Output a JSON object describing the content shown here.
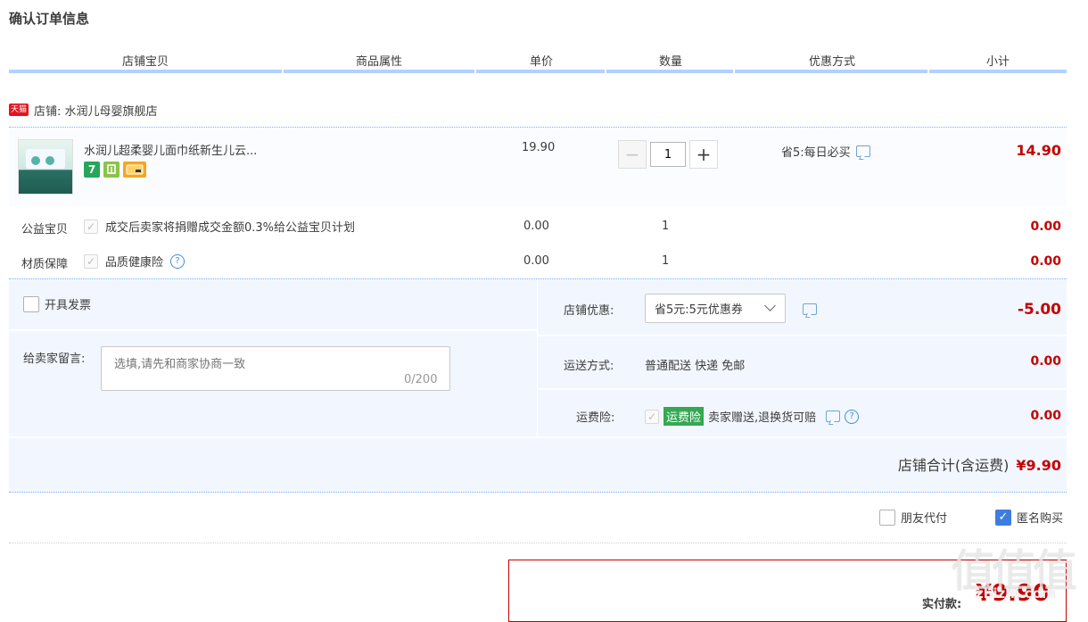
{
  "page_title": "确认订单信息",
  "columns": [
    "店铺宝贝",
    "商品属性",
    "单价",
    "数量",
    "优惠方式",
    "小计"
  ],
  "shop": {
    "badge": "天猫",
    "label": "店铺: 水润儿母婴旗舰店"
  },
  "item": {
    "name": "水润儿超柔婴儿面巾纸新生儿云...",
    "badges": [
      "7",
      "",
      ""
    ],
    "price": "19.90",
    "quantity": "1",
    "minus": "−",
    "plus": "+",
    "promo": "省5:每日必买",
    "subtotal": "14.90"
  },
  "services": [
    {
      "label": "公益宝贝",
      "text": "成交后卖家将捐赠成交金额0.3%给公益宝贝计划",
      "price": "0.00",
      "qty": "1",
      "subtotal": "0.00"
    },
    {
      "label": "材质保障",
      "text": "品质健康险",
      "price": "0.00",
      "qty": "1",
      "subtotal": "0.00"
    }
  ],
  "invoice": {
    "label": "开具发票"
  },
  "message": {
    "label": "给卖家留言:",
    "placeholder": "选填,请先和商家协商一致",
    "counter": "0/200"
  },
  "shop_discount": {
    "label": "店铺优惠:",
    "selected": "省5元:5元优惠券",
    "amount": "-5.00"
  },
  "shipping": {
    "label": "运送方式:",
    "value": "普通配送 快递 免邮",
    "amount": "0.00"
  },
  "insurance": {
    "label": "运费险:",
    "tag": "运费险",
    "text": "卖家赠送,退换货可赔",
    "amount": "0.00"
  },
  "shop_total": {
    "label": "店铺合计(含运费)",
    "amount": "¥9.90"
  },
  "options": {
    "friend_pay": "朋友代付",
    "anonymous": "匿名购买"
  },
  "payment": {
    "label": "实付款:",
    "amount": "¥9.90"
  },
  "watermark": {
    "text": "值值值",
    "url": "zhizhi.com"
  },
  "colors": {
    "accent_red": "#c40000",
    "header_bar": "#b2d1ff",
    "panel_bg": "#f2f7ff",
    "checkbox_blue": "#3e7de0",
    "tag_green": "#34a853"
  }
}
